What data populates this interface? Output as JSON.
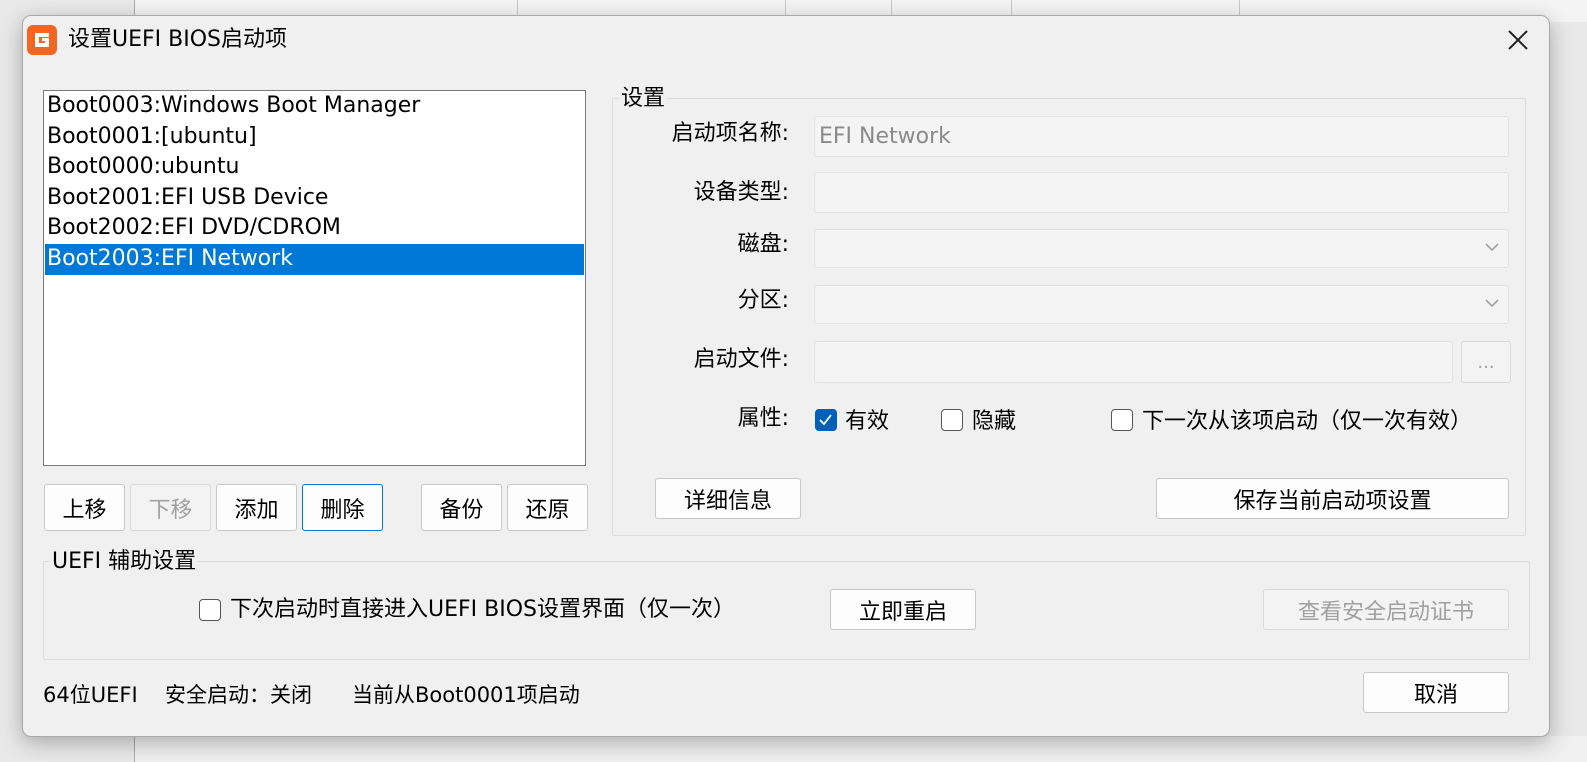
{
  "window": {
    "title": "设置UEFI BIOS启动项"
  },
  "boot_list": {
    "items": [
      {
        "label": "Boot0003:Windows Boot Manager"
      },
      {
        "label": "Boot0001:[ubuntu]"
      },
      {
        "label": "Boot0000:ubuntu"
      },
      {
        "label": "Boot2001:EFI USB Device"
      },
      {
        "label": "Boot2002:EFI DVD/CDROM"
      },
      {
        "label": "Boot2003:EFI Network"
      }
    ],
    "selected_index": 5
  },
  "list_buttons": {
    "move_up": "上移",
    "move_down": "下移",
    "add": "添加",
    "delete": "删除",
    "backup": "备份",
    "restore": "还原"
  },
  "settings": {
    "group_title": "设置",
    "name_label": "启动项名称:",
    "name_value": "EFI Network",
    "device_type_label": "设备类型:",
    "device_type_value": "",
    "disk_label": "磁盘:",
    "disk_value": "",
    "partition_label": "分区:",
    "partition_value": "",
    "boot_file_label": "启动文件:",
    "boot_file_value": "",
    "browse_label": "...",
    "attributes_label": "属性:",
    "valid_label": "有效",
    "valid_checked": true,
    "hidden_label": "隐藏",
    "hidden_checked": false,
    "next_boot_label": "下一次从该项启动（仅一次有效）",
    "next_boot_checked": false,
    "details_button": "详细信息",
    "save_button": "保存当前启动项设置"
  },
  "uefi_aux": {
    "group_title": "UEFI 辅助设置",
    "enter_bios_label": "下次启动时直接进入UEFI BIOS设置界面（仅一次）",
    "enter_bios_checked": false,
    "restart_button": "立即重启",
    "view_cert_button": "查看安全启动证书"
  },
  "status_bar": {
    "arch": "64位UEFI",
    "secure_boot": "安全启动：关闭",
    "current_boot": "当前从Boot0001项启动"
  },
  "footer": {
    "cancel_button": "取消"
  },
  "colors": {
    "accent": "#0078d7",
    "checkbox_checked": "#005fb8",
    "app_icon": "#f26522"
  }
}
